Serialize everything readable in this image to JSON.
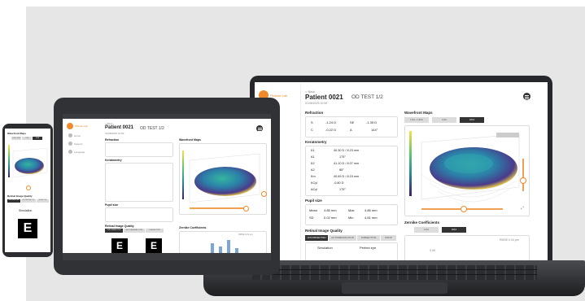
{
  "app": {
    "brand": "Pinhole Lab"
  },
  "nav": {
    "items": [
      "Home",
      "Support",
      "Language"
    ]
  },
  "patient": {
    "back_label": "< Back",
    "title_bold": "Patient 0021",
    "title_rest": "OD TEST 1/2",
    "date": "01/08/2025 10:59"
  },
  "refraction": {
    "title": "Refraction",
    "rows": [
      {
        "label": "S",
        "value": "-1.24 D",
        "label2": "SE",
        "value2": "-1.35 D"
      },
      {
        "label": "C",
        "value": "-0.22 D",
        "label2": "A",
        "value2": "144°"
      }
    ]
  },
  "keratometry": {
    "title": "Keratometry",
    "rows": [
      {
        "label": "K1",
        "value": "40.30 D / 8.23 mm"
      },
      {
        "label": "A1",
        "value": "175°"
      },
      {
        "label": "K2",
        "value": "41.10 D / 8.07 mm"
      },
      {
        "label": "A2",
        "value": "85°"
      },
      {
        "label": "Km",
        "value": "40.69 D / 8.15 mm"
      },
      {
        "label": "KCyl",
        "value": "-0.80 D"
      },
      {
        "label": "ACyl",
        "value": "175°"
      }
    ]
  },
  "pupil": {
    "title": "Pupil size",
    "rows": [
      {
        "label": "Mean",
        "value": "4.85 mm",
        "label2": "Max",
        "value2": "4.86 mm"
      },
      {
        "label": "SD",
        "value": "0.02 mm",
        "label2": "Min",
        "value2": "4.81 mm"
      }
    ]
  },
  "wavefront": {
    "title": "Wavefront Maps",
    "tabs": [
      "LOA + HOA",
      "LOA",
      "HOA"
    ],
    "active_tab": 2
  },
  "retinal": {
    "title": "Retinal Image Quality",
    "tabs": [
      "UNCORRECTED",
      "AUTOREFRACTION",
      "SUBJECTIVE",
      "PROP"
    ],
    "simulation_label": "Simulation",
    "perfect_label": "Perfect eye",
    "letter": "E"
  },
  "zernike": {
    "title": "Zernike Coefficients",
    "tabs": [
      "LOA",
      "HOA"
    ],
    "rmse": "RMSE 0.04 µm",
    "axis_tick": "0.06"
  },
  "colors": {
    "accent": "#f08a2a",
    "dark": "#333333",
    "bars": "#7aa6d8"
  },
  "icons": [
    "info-icon",
    "menu-icon",
    "home-icon",
    "support-icon",
    "language-icon",
    "fullscreen-icon"
  ]
}
